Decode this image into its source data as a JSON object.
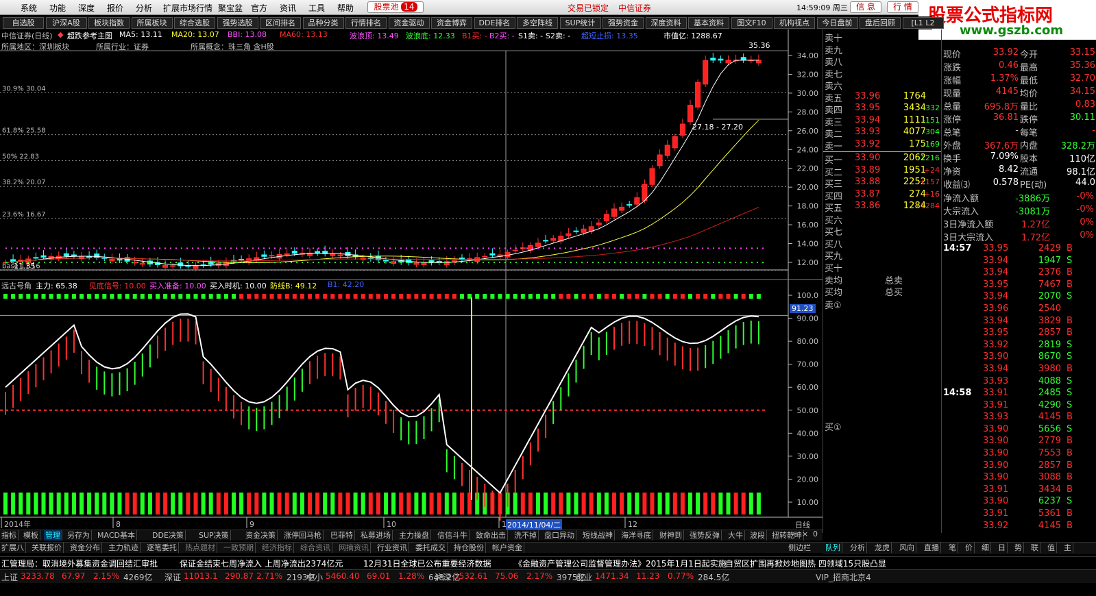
{
  "menu": {
    "items": [
      "系统",
      "功能",
      "深度",
      "报价",
      "分析",
      "扩展市场行情",
      "聚宝盆",
      "官方",
      "资讯",
      "工具",
      "帮助"
    ],
    "pool_label": "股票池",
    "pool_count": "14",
    "lock_text": "交易已锁定",
    "broker": "中信证券",
    "time": "14:59:09 周三",
    "trade1": "信 息",
    "trade2": "行 情"
  },
  "watermark": {
    "title": "股票公式指标网",
    "url": "www.gszb.com"
  },
  "toolbar": {
    "buttons": [
      "自选股",
      "沪深A股",
      "板块指数",
      "所属板块",
      "综合选股",
      "强势选股",
      "区间排名",
      "品种分类",
      "行情排名",
      "资金驱动",
      "资金博弈",
      "DDE排名",
      "多空阵线",
      "SUP统计",
      "强势资金",
      "深度资料",
      "基本资料",
      "图文F10",
      "机构视点",
      "今日盘前",
      "盘后回顾",
      "[L1 L2"
    ]
  },
  "chart": {
    "stock_title": "中信证券(日线)",
    "main_label": "超跌参考主图",
    "ma5": "MA5: 13.11",
    "ma20": "MA20: 13.07",
    "bbi": "BBI: 13.08",
    "ma60": "MA60: 13.13",
    "wave_top": "波浪顶: 13.49",
    "wave_bot": "波浪底: 12.33",
    "b1buy": "B1买: -",
    "b2buy": "B2买: -",
    "s1sell": "S1卖: -",
    "s2sell": "S2卖: -",
    "overbought": "超短止损: 13.35",
    "mcap": "市值亿: 1288.67",
    "region": "所属地区：深圳板块",
    "industry": "所属行业：证券",
    "concept": "所属概念：珠三角 含H股",
    "fib": [
      "30.9% 30.04",
      "61.8% 25.58",
      "50% 22.83",
      "38.2% 20.07",
      "23.6% 16.67",
      "base 11.16"
    ],
    "price_ticks": [
      "34.00",
      "32.00",
      "30.00",
      "28.00",
      "26.00",
      "24.00",
      "22.00",
      "20.00",
      "18.00",
      "16.00",
      "14.00",
      "12.00"
    ],
    "annot_high": "35.36",
    "annot_range": "27.18 - 27.20",
    "annot_low": "11.35",
    "osc_title": "远古号角",
    "osc_main": "主力: 65.38",
    "osc_sig1": "见底信号: 10.00",
    "osc_sig2": "买入准备: 10.00",
    "osc_sig3": "买入时机: 10.00",
    "osc_def": "防线B: 49.12",
    "osc_b1": "B1: 42.20",
    "osc_ticks": [
      "100.0",
      "90.00",
      "80.00",
      "70.00",
      "60.00",
      "50.00",
      "40.00",
      "30.00",
      "20.00",
      "10.00"
    ],
    "osc_cursor": "91.23",
    "dates": [
      "2014年",
      "8",
      "9",
      "10",
      "11",
      "12"
    ],
    "cursor_date": "2014/11/04/二",
    "period": "日线"
  },
  "orderbook": {
    "sell_labels": [
      "卖十",
      "卖九",
      "卖八",
      "卖七",
      "卖六",
      "卖五",
      "卖四",
      "卖三",
      "卖二",
      "卖一"
    ],
    "sell": [
      [
        "",
        "",
        ""
      ],
      [
        "",
        "",
        ""
      ],
      [
        "",
        "",
        ""
      ],
      [
        "",
        "",
        ""
      ],
      [
        "",
        "",
        ""
      ],
      [
        "33.96",
        "1764",
        ""
      ],
      [
        "33.95",
        "3434",
        "-332"
      ],
      [
        "33.94",
        "1111",
        "-151"
      ],
      [
        "33.93",
        "4077",
        "-304"
      ],
      [
        "33.92",
        "175",
        "-169"
      ]
    ],
    "buy_labels": [
      "买一",
      "买二",
      "买三",
      "买四",
      "买五",
      "买六",
      "买七",
      "买八",
      "买九",
      "买十"
    ],
    "buy": [
      [
        "33.90",
        "2062",
        "-1216"
      ],
      [
        "33.89",
        "1951",
        "+24"
      ],
      [
        "33.88",
        "2252",
        "+157"
      ],
      [
        "33.87",
        "274",
        "+16"
      ],
      [
        "33.86",
        "1284",
        "+1284"
      ],
      [
        "",
        "",
        ""
      ],
      [
        "",
        "",
        ""
      ],
      [
        "",
        "",
        ""
      ],
      [
        "",
        "",
        ""
      ],
      [
        "",
        "",
        ""
      ]
    ],
    "avg_sell": "卖均",
    "avg_buy": "买均",
    "total_sell": "总卖",
    "total_buy": "总买",
    "sell_queue": "卖①",
    "buy_queue": "买①"
  },
  "quote": {
    "rows": [
      [
        "现价",
        "33.92",
        "今开",
        "33.15"
      ],
      [
        "涨跌",
        "0.46",
        "最高",
        "35.36"
      ],
      [
        "涨幅",
        "1.37%",
        "最低",
        "32.70"
      ],
      [
        "现量",
        "4145",
        "均价",
        "34.15"
      ],
      [
        "总量",
        "695.8万",
        "量比",
        "0.83"
      ],
      [
        "涨停",
        "36.81",
        "跌停",
        "30.11"
      ],
      [
        "总笔",
        "-",
        "每笔",
        "-"
      ],
      [
        "外盘",
        "367.6万",
        "内盘",
        "328.2万"
      ],
      [
        "换手",
        "7.09%",
        "股本",
        "110亿"
      ],
      [
        "净资",
        "8.42",
        "流通",
        "98.1亿"
      ],
      [
        "收益⑶",
        "0.578",
        "PE(动)",
        "44.0"
      ]
    ],
    "flow": [
      [
        "净流入额",
        "-3886万",
        "-0%"
      ],
      [
        "大宗流入",
        "-3081万",
        "-0%"
      ],
      [
        "3日净流入额",
        "1.27亿",
        "0%"
      ],
      [
        "3日大宗流入",
        "1.72亿",
        "0%"
      ]
    ],
    "ticks1_time": "14:57",
    "ticks1": [
      [
        "33.95",
        "2429",
        "B"
      ],
      [
        "33.94",
        "1947",
        "S"
      ],
      [
        "33.94",
        "2376",
        "B"
      ],
      [
        "33.95",
        "7467",
        "B"
      ],
      [
        "33.94",
        "2070",
        "S"
      ],
      [
        "33.96",
        "2540",
        ""
      ],
      [
        "33.94",
        "3829",
        "B"
      ],
      [
        "33.95",
        "2857",
        "B"
      ],
      [
        "33.92",
        "2819",
        "S"
      ],
      [
        "33.90",
        "8670",
        "S"
      ],
      [
        "33.94",
        "3980",
        "B"
      ],
      [
        "33.93",
        "4088",
        "S"
      ]
    ],
    "ticks2_time": "14:58",
    "ticks2": [
      [
        "33.91",
        "2485",
        "S"
      ],
      [
        "33.91",
        "4290",
        "S"
      ],
      [
        "33.93",
        "4145",
        "B"
      ],
      [
        "33.90",
        "5656",
        "S"
      ],
      [
        "33.90",
        "2779",
        "B"
      ],
      [
        "33.90",
        "7553",
        "B"
      ],
      [
        "33.90",
        "2857",
        "B"
      ],
      [
        "33.90",
        "3088",
        "B"
      ],
      [
        "33.91",
        "3434",
        "B"
      ],
      [
        "33.90",
        "6237",
        "S"
      ],
      [
        "33.91",
        "5361",
        "B"
      ],
      [
        "33.92",
        "4145",
        "B"
      ]
    ]
  },
  "tabs1": [
    "指标",
    "模板",
    "管理",
    "另存为",
    "MACD基本",
    "DDE决策",
    "SUP决策",
    "资金决策",
    "涨停回马枪",
    "巴菲特",
    "私募进场",
    "主力操盘",
    "信信斗牛",
    "致命出击",
    "洗不掉",
    "盘口异动",
    "短线战神",
    "海洋寻底",
    "财神到",
    "强势反弹",
    "大牛",
    "波段",
    "扭转乾坤"
  ],
  "tabs2": [
    "扩展八",
    "关联报价",
    "资金分布",
    "主力轨迹",
    "逐笔委托",
    "热点题材",
    "一致预期",
    "经济指标",
    "综合资讯",
    "网摘资讯",
    "行业资讯",
    "委托成交",
    "持仓股份",
    "帐户资金"
  ],
  "side_tabs": [
    "侧边栏",
    "+",
    "-"
  ],
  "info_tabs": [
    "队列",
    "分析",
    "龙虎",
    "风向",
    "直播",
    "笔",
    "价",
    "细",
    "日",
    "势",
    "联",
    "值",
    "主"
  ],
  "news": [
    "汇管理局：取消境外募集资金调回结汇审批",
    "保证金结束七周净流入 上周净流出2374亿元",
    "12月31日全球已公布重要经济数据",
    "《金融资产管理公司监督管理办法》2015年1月1日起实施",
    "自贸区扩围再掀炒地图热 四领域15只股凸显"
  ],
  "index": [
    [
      "上证",
      "3233.78",
      "67.97",
      "2.15%",
      "4269亿"
    ],
    [
      "深证",
      "11013.1",
      "290.87",
      "2.71%",
      "2193亿"
    ],
    [
      "中小",
      "5460.40",
      "69.01",
      "1.28%",
      "648.2亿"
    ],
    [
      "沪深",
      "3532.61",
      "75.06",
      "2.17%",
      "3975亿"
    ],
    [
      "创业",
      "1471.34",
      "11.23",
      "0.77%",
      "284.5亿"
    ]
  ],
  "vip": "VIP_招商北京4"
}
